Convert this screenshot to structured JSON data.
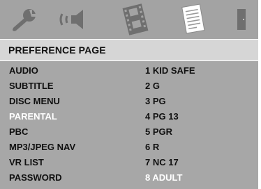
{
  "tabs": [
    {
      "name": "general-setup",
      "icon": "wrench-icon"
    },
    {
      "name": "audio-setup",
      "icon": "speaker-icon"
    },
    {
      "name": "video-setup",
      "icon": "film-icon"
    },
    {
      "name": "preference",
      "icon": "document-icon"
    },
    {
      "name": "exit",
      "icon": "door-icon"
    }
  ],
  "page_title": "PREFERENCE PAGE",
  "menu_items": [
    "AUDIO",
    "SUBTITLE",
    "DISC MENU",
    "PARENTAL",
    "PBC",
    "MP3/JPEG NAV",
    "VR LIST",
    "PASSWORD"
  ],
  "options": [
    "1 KID SAFE",
    "2 G",
    "3 PG",
    "4 PG 13",
    "5 PGR",
    "6 R",
    "7 NC 17",
    "8 ADULT"
  ],
  "selected_menu_item": "PARENTAL",
  "selected_option": "8 ADULT",
  "colors": {
    "icon_bar": "#a3a3a3",
    "title_bar": "#d6d6d6",
    "body": "#a7a7a7",
    "highlight_text": "#ffffff"
  }
}
